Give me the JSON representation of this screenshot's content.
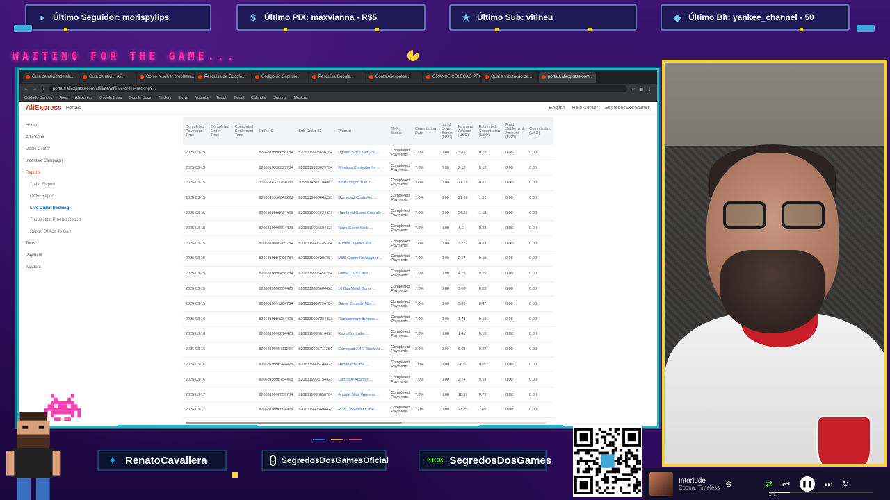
{
  "alerts": {
    "follower": "Último Seguidor: morispylips",
    "pix": "Último PIX: maxvianna - R$5",
    "sub": "Último Sub: vitineu",
    "bit": "Último Bit: yankee_channel - 50"
  },
  "waiting_text": "WAITING FOR THE GAME...",
  "browser": {
    "tabs": [
      "Guia de atividade ali...",
      "Guia de ativi... Ali...",
      "Como resolver problema...",
      "Pesquisa de Google...",
      "Código do Capítulo...",
      "Pesquisa Google...",
      "Conta Aliexpress...",
      "GRANDE COLEÇÃO PRO...",
      "Qual a tributação de...",
      "portals.aliexpress.com..."
    ],
    "url": "portals.aliexpress.com/affiliate/affiliate-order-tracking?...",
    "bookmarks": [
      "Cuidado Bancos",
      "Apps",
      "Aliexpress",
      "Google Drive",
      "Google Docs",
      "Tracking",
      "Drive",
      "Youtube",
      "Twitch",
      "Gmail",
      "Calendar",
      "Suporte",
      "Musicas"
    ],
    "app_logo": "AliExpress",
    "app_sub": "Portals",
    "header_right": [
      "English",
      "Help Center",
      "SegredosDosGames"
    ],
    "sidebar": [
      {
        "label": "Home",
        "kind": "item"
      },
      {
        "label": "Ad Center",
        "kind": "item"
      },
      {
        "label": "Deals Center",
        "kind": "item"
      },
      {
        "label": "Incentive Campaign",
        "kind": "item"
      },
      {
        "label": "Reports",
        "kind": "grp"
      },
      {
        "label": "Traffic Report",
        "kind": "sub"
      },
      {
        "label": "Order Report",
        "kind": "sub"
      },
      {
        "label": "Live Order Tracking",
        "kind": "active"
      },
      {
        "label": "Transaction Product Report",
        "kind": "sub"
      },
      {
        "label": "Report Of Add To Cart",
        "kind": "sub"
      },
      {
        "label": "Tools",
        "kind": "item"
      },
      {
        "label": "Payment",
        "kind": "item"
      },
      {
        "label": "Account",
        "kind": "item"
      }
    ],
    "columns": [
      "Completed Payments Time",
      "Completed Order Time",
      "Completed Settlement Time",
      "Order ID",
      "Sub Order ID",
      "Product",
      "Order Status",
      "Commission Rate",
      "Initial Buyer Bonus (USD)",
      "Payment Amount (USD)",
      "Estimated Commission (USD)",
      "Final Settlement Amount (USD)",
      "Commission (USD)"
    ],
    "rows": [
      [
        "2025-03-15",
        "",
        "",
        "8206319996656784",
        "8206319996656784",
        "Ugreen 5 in 1 Hub for ...",
        "Completed Payments",
        "7.0%",
        "0.00",
        "3.41",
        "0.19",
        "0.00",
        "0.00"
      ],
      [
        "2025-03-15",
        "",
        "",
        "8206319996629784",
        "8206319996629784",
        "Wireless Controller for ...",
        "Completed Payments",
        "7.0%",
        "0.00",
        "2.12",
        "0.12",
        "0.00",
        "0.00"
      ],
      [
        "2025-03-15",
        "",
        "",
        "3055674327784083",
        "3055674327784083",
        "8-Bit Dragon Ball Z ...",
        "Completed Payments",
        "3.0%",
        "0.00",
        "21.18",
        "0.21",
        "0.00",
        "0.00"
      ],
      [
        "2025-03-15",
        "",
        "",
        "8206319996640223",
        "8206319996640223",
        "Gamepad Controller ...",
        "Completed Payments",
        "7.0%",
        "0.00",
        "21.18",
        "1.31",
        "0.00",
        "0.00"
      ],
      [
        "2025-03-15",
        "",
        "",
        "8206319996634423",
        "8206319996634423",
        "Handheld Game Console ...",
        "Completed Payments",
        "7.0%",
        "0.00",
        "24.22",
        "1.13",
        "0.00",
        "0.00"
      ],
      [
        "2025-03-15",
        "",
        "",
        "8206319996604423",
        "8206319996604423",
        "Retro Game Stick ...",
        "Completed Payments",
        "7.0%",
        "0.00",
        "4.11",
        "0.22",
        "0.00",
        "0.00"
      ],
      [
        "2025-03-15",
        "",
        "",
        "8206319996785784",
        "8206319996785784",
        "Arcade Joystick Kit ...",
        "Completed Payments",
        "7.0%",
        "0.00",
        "3.27",
        "0.23",
        "0.00",
        "0.00"
      ],
      [
        "2025-03-15",
        "",
        "",
        "8206319997296784",
        "8206319997296784",
        "USB Controller Adapter ...",
        "Completed Payments",
        "7.0%",
        "0.00",
        "2.17",
        "0.15",
        "0.00",
        "0.00"
      ],
      [
        "2025-03-15",
        "",
        "",
        "8206319996456784",
        "8206319996456784",
        "Game Card Case ...",
        "Completed Payments",
        "7.0%",
        "0.00",
        "4.15",
        "0.29",
        "0.00",
        "0.00"
      ],
      [
        "2025-03-15",
        "",
        "",
        "8206319996604423",
        "8206319996604423",
        "16 Bits Metal Game ...",
        "Completed Payments",
        "7.0%",
        "0.00",
        "3.06",
        "0.22",
        "0.00",
        "0.00"
      ],
      [
        "2025-03-15",
        "",
        "",
        "8206319997294784",
        "8206319997294784",
        "Game Console Mini ...",
        "Completed Payments",
        "7.0%",
        "0.00",
        "5.85",
        "0.47",
        "0.00",
        "0.00"
      ],
      [
        "2025-03-16",
        "",
        "",
        "8206319997284423",
        "8206319997284423",
        "Replacement Buttons ...",
        "Completed Payments",
        "7.0%",
        "0.00",
        "1.78",
        "0.19",
        "0.00",
        "0.00"
      ],
      [
        "2025-03-16",
        "",
        "",
        "8206319996614423",
        "8206319996614423",
        "Retro Controller ...",
        "Completed Payments",
        "7.0%",
        "0.00",
        "1.41",
        "0.10",
        "0.00",
        "0.00"
      ],
      [
        "2025-03-16",
        "",
        "",
        "8206319996711284",
        "8206319996711284",
        "Gamepad 2.4G Wireless ...",
        "Completed Payments",
        "3.0%",
        "0.00",
        "6.03",
        "0.22",
        "0.00",
        "0.00"
      ],
      [
        "2025-03-16",
        "",
        "",
        "8206319996744423",
        "8206319996744423",
        "Handheld Case ...",
        "Completed Payments",
        "7.0%",
        "0.00",
        "26.57",
        "0.05",
        "0.00",
        "0.00"
      ],
      [
        "2025-03-16",
        "",
        "",
        "8206319996754423",
        "8206319996754423",
        "Cartridge Adapter ...",
        "Completed Payments",
        "7.0%",
        "0.00",
        "2.74",
        "0.19",
        "0.00",
        "0.00"
      ],
      [
        "2025-03-17",
        "",
        "",
        "8206319996656784",
        "8206319996656784",
        "Arcade Stick Wireless ...",
        "Completed Payments",
        "7.0%",
        "0.00",
        "10.57",
        "0.79",
        "0.00",
        "0.00"
      ],
      [
        "2025-03-17",
        "",
        "",
        "8206319996604423",
        "8206319996604423",
        "RGB Controller Case ...",
        "Completed Payments",
        "7.0%",
        "0.00",
        "23.25",
        "2.09",
        "0.00",
        "0.00"
      ]
    ]
  },
  "socials": {
    "twitter": "RenatoCavallera",
    "instagram": "SegredosDosGamesOficial",
    "kick_badge": "KICK",
    "kick": "SegredosDosGames"
  },
  "qr_url": "livepix.gg/segredosdosgames",
  "player": {
    "title": "Interlude",
    "artist": "Epona, Timeless",
    "time": "2:11",
    "progress": 0.2
  },
  "colors": {
    "accent_cyan": "#22b3c6",
    "cam_border": "#f4d43a",
    "ali_red": "#e62e04",
    "neon_pink": "#ff2fa8"
  }
}
